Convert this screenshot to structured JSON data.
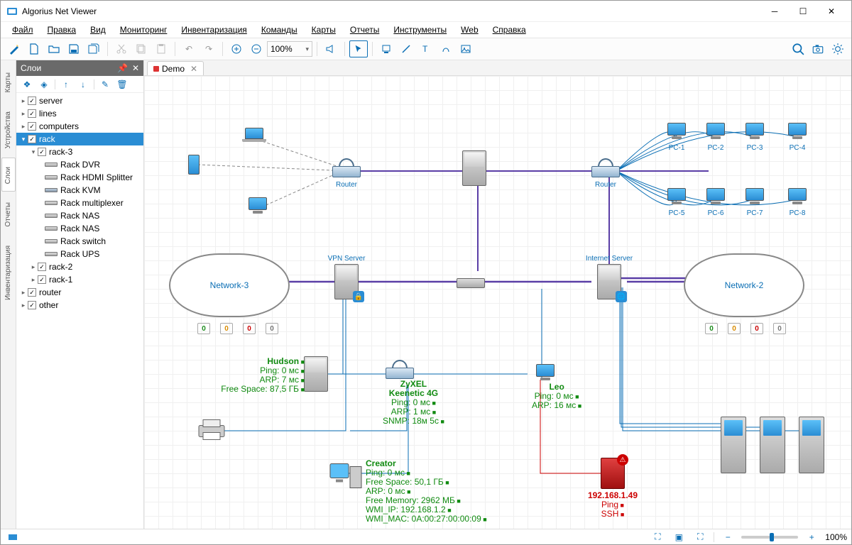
{
  "app": {
    "title": "Algorius Net Viewer"
  },
  "menu": [
    "Файл",
    "Правка",
    "Вид",
    "Мониторинг",
    "Инвентаризация",
    "Команды",
    "Карты",
    "Отчеты",
    "Инструменты",
    "Web",
    "Справка"
  ],
  "toolbar_zoom": "100%",
  "left_tabs": [
    "Карты",
    "Устройства",
    "Слои",
    "Отчеты",
    "Инвентаризация"
  ],
  "panel": {
    "title": "Слои"
  },
  "tree": {
    "l1": [
      "server",
      "lines",
      "computers",
      "rack",
      "router",
      "other"
    ],
    "rack_children": [
      "rack-3",
      "rack-2",
      "rack-1"
    ],
    "rack3_items": [
      "Rack DVR",
      "Rack HDMI Splitter",
      "Rack KVM",
      "Rack multiplexer",
      "Rack NAS",
      "Rack NAS",
      "Rack switch",
      "Rack UPS"
    ]
  },
  "tab": {
    "name": "Demo"
  },
  "labels": {
    "router1": "Router",
    "router2": "Router",
    "vpn": "VPN Server",
    "inet": "Internet Server",
    "net3": "Network-3",
    "net2": "Network-2",
    "pcs": [
      "PC-1",
      "PC-2",
      "PC-3",
      "PC-4",
      "PC-5",
      "PC-6",
      "PC-7",
      "PC-8"
    ]
  },
  "counters3": [
    "0",
    "0",
    "0",
    "0"
  ],
  "counters2": [
    "0",
    "0",
    "0",
    "0"
  ],
  "hudson": {
    "name": "Hudson",
    "l1": "Ping: 0 мс",
    "l2": "ARP: 7 мс",
    "l3": "Free Space: 87,5 ГБ"
  },
  "zyxel": {
    "name": "ZyXEL",
    "sub": "Keenetic 4G",
    "l1": "Ping: 0 мс",
    "l2": "ARP: 1 мс",
    "l3": "SNMP: 18м 5c"
  },
  "leo": {
    "name": "Leo",
    "l1": "Ping: 0 мс",
    "l2": "ARP: 16 мс"
  },
  "creator": {
    "name": "Creator",
    "l1": "Ping: 0 мс",
    "l2": "Free Space: 50,1 ГБ",
    "l3": "ARP: 0 мс",
    "l4": "Free Memory: 2962 МБ",
    "l5": "WMI_IP: 192.168.1.2",
    "l6": "WMI_MAC:  0A:00:27:00:00:09"
  },
  "failed": {
    "ip": "192.168.1.49",
    "l1": "Ping",
    "l2": "SSH"
  },
  "status": {
    "zoom": "100%"
  }
}
